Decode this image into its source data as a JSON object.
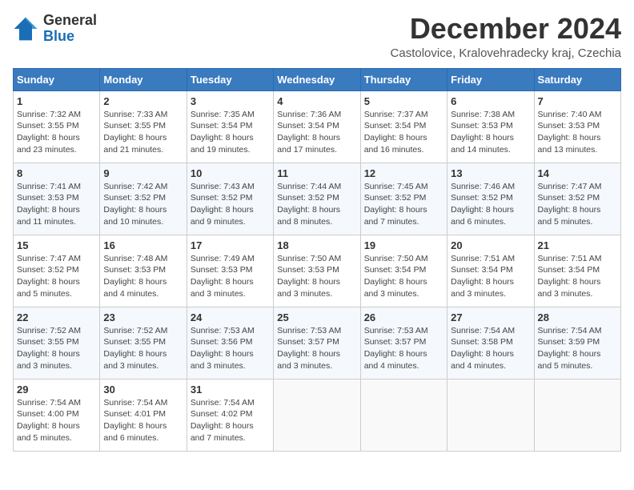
{
  "logo": {
    "general": "General",
    "blue": "Blue"
  },
  "title": {
    "month_year": "December 2024",
    "location": "Castolovice, Kralovehradecky kraj, Czechia"
  },
  "weekdays": [
    "Sunday",
    "Monday",
    "Tuesday",
    "Wednesday",
    "Thursday",
    "Friday",
    "Saturday"
  ],
  "weeks": [
    [
      {
        "day": "1",
        "sunrise": "7:32 AM",
        "sunset": "3:55 PM",
        "daylight": "8 hours and 23 minutes."
      },
      {
        "day": "2",
        "sunrise": "7:33 AM",
        "sunset": "3:55 PM",
        "daylight": "8 hours and 21 minutes."
      },
      {
        "day": "3",
        "sunrise": "7:35 AM",
        "sunset": "3:54 PM",
        "daylight": "8 hours and 19 minutes."
      },
      {
        "day": "4",
        "sunrise": "7:36 AM",
        "sunset": "3:54 PM",
        "daylight": "8 hours and 17 minutes."
      },
      {
        "day": "5",
        "sunrise": "7:37 AM",
        "sunset": "3:54 PM",
        "daylight": "8 hours and 16 minutes."
      },
      {
        "day": "6",
        "sunrise": "7:38 AM",
        "sunset": "3:53 PM",
        "daylight": "8 hours and 14 minutes."
      },
      {
        "day": "7",
        "sunrise": "7:40 AM",
        "sunset": "3:53 PM",
        "daylight": "8 hours and 13 minutes."
      }
    ],
    [
      {
        "day": "8",
        "sunrise": "7:41 AM",
        "sunset": "3:53 PM",
        "daylight": "8 hours and 11 minutes."
      },
      {
        "day": "9",
        "sunrise": "7:42 AM",
        "sunset": "3:52 PM",
        "daylight": "8 hours and 10 minutes."
      },
      {
        "day": "10",
        "sunrise": "7:43 AM",
        "sunset": "3:52 PM",
        "daylight": "8 hours and 9 minutes."
      },
      {
        "day": "11",
        "sunrise": "7:44 AM",
        "sunset": "3:52 PM",
        "daylight": "8 hours and 8 minutes."
      },
      {
        "day": "12",
        "sunrise": "7:45 AM",
        "sunset": "3:52 PM",
        "daylight": "8 hours and 7 minutes."
      },
      {
        "day": "13",
        "sunrise": "7:46 AM",
        "sunset": "3:52 PM",
        "daylight": "8 hours and 6 minutes."
      },
      {
        "day": "14",
        "sunrise": "7:47 AM",
        "sunset": "3:52 PM",
        "daylight": "8 hours and 5 minutes."
      }
    ],
    [
      {
        "day": "15",
        "sunrise": "7:47 AM",
        "sunset": "3:52 PM",
        "daylight": "8 hours and 5 minutes."
      },
      {
        "day": "16",
        "sunrise": "7:48 AM",
        "sunset": "3:53 PM",
        "daylight": "8 hours and 4 minutes."
      },
      {
        "day": "17",
        "sunrise": "7:49 AM",
        "sunset": "3:53 PM",
        "daylight": "8 hours and 3 minutes."
      },
      {
        "day": "18",
        "sunrise": "7:50 AM",
        "sunset": "3:53 PM",
        "daylight": "8 hours and 3 minutes."
      },
      {
        "day": "19",
        "sunrise": "7:50 AM",
        "sunset": "3:54 PM",
        "daylight": "8 hours and 3 minutes."
      },
      {
        "day": "20",
        "sunrise": "7:51 AM",
        "sunset": "3:54 PM",
        "daylight": "8 hours and 3 minutes."
      },
      {
        "day": "21",
        "sunrise": "7:51 AM",
        "sunset": "3:54 PM",
        "daylight": "8 hours and 3 minutes."
      }
    ],
    [
      {
        "day": "22",
        "sunrise": "7:52 AM",
        "sunset": "3:55 PM",
        "daylight": "8 hours and 3 minutes."
      },
      {
        "day": "23",
        "sunrise": "7:52 AM",
        "sunset": "3:55 PM",
        "daylight": "8 hours and 3 minutes."
      },
      {
        "day": "24",
        "sunrise": "7:53 AM",
        "sunset": "3:56 PM",
        "daylight": "8 hours and 3 minutes."
      },
      {
        "day": "25",
        "sunrise": "7:53 AM",
        "sunset": "3:57 PM",
        "daylight": "8 hours and 3 minutes."
      },
      {
        "day": "26",
        "sunrise": "7:53 AM",
        "sunset": "3:57 PM",
        "daylight": "8 hours and 4 minutes."
      },
      {
        "day": "27",
        "sunrise": "7:54 AM",
        "sunset": "3:58 PM",
        "daylight": "8 hours and 4 minutes."
      },
      {
        "day": "28",
        "sunrise": "7:54 AM",
        "sunset": "3:59 PM",
        "daylight": "8 hours and 5 minutes."
      }
    ],
    [
      {
        "day": "29",
        "sunrise": "7:54 AM",
        "sunset": "4:00 PM",
        "daylight": "8 hours and 5 minutes."
      },
      {
        "day": "30",
        "sunrise": "7:54 AM",
        "sunset": "4:01 PM",
        "daylight": "8 hours and 6 minutes."
      },
      {
        "day": "31",
        "sunrise": "7:54 AM",
        "sunset": "4:02 PM",
        "daylight": "8 hours and 7 minutes."
      },
      null,
      null,
      null,
      null
    ]
  ],
  "labels": {
    "sunrise": "Sunrise:",
    "sunset": "Sunset:",
    "daylight": "Daylight hours"
  }
}
